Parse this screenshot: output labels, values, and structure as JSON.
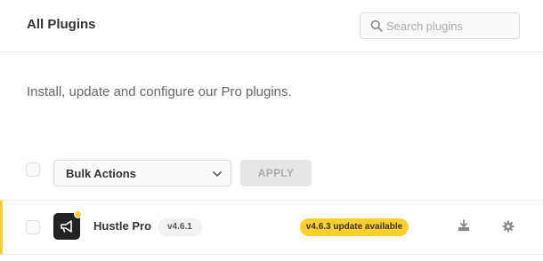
{
  "header": {
    "title": "All Plugins",
    "search": {
      "placeholder": "Search plugins",
      "value": "",
      "icon": "search-icon"
    }
  },
  "description": "Install, update and configure our Pro plugins.",
  "bulk": {
    "select_label": "Bulk Actions",
    "apply_label": "APPLY"
  },
  "plugins": [
    {
      "name": "Hustle Pro",
      "version": "v4.6.1",
      "update_label": "v4.6.3 update available",
      "icon": "megaphone-icon",
      "actions": [
        "download-icon",
        "gear-icon"
      ]
    }
  ],
  "colors": {
    "accent_yellow": "#fecf2f",
    "border": "#e6e6e6",
    "text": "#333333",
    "muted": "#aaaaaa"
  }
}
